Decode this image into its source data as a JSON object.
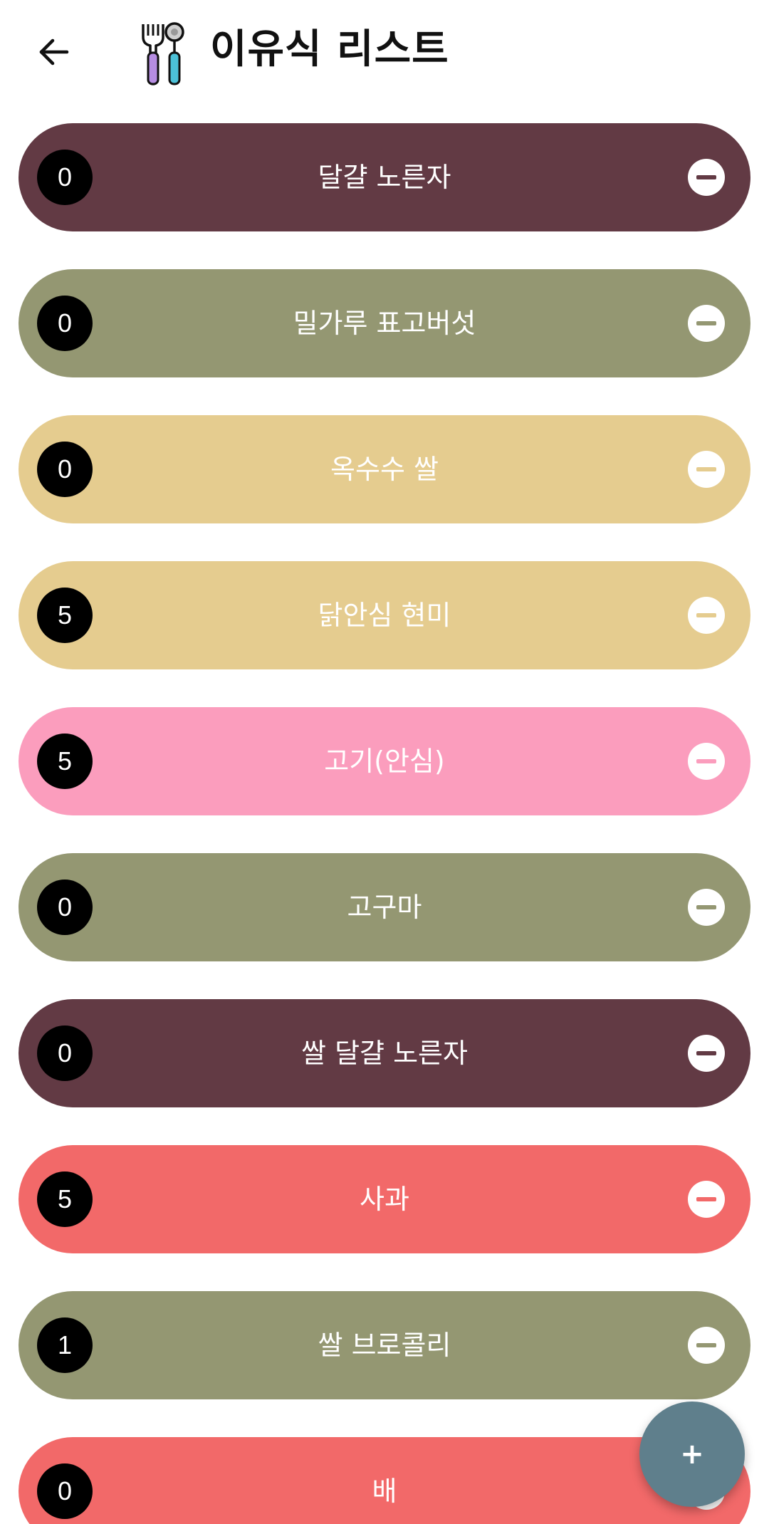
{
  "header": {
    "title": "이유식 리스트",
    "back_icon": "arrow-left-icon",
    "app_icon": "fork-spoon-icon"
  },
  "items": [
    {
      "name": "달걀 노른자",
      "count": "0",
      "color": "#623a44"
    },
    {
      "name": "밀가루 표고버섯",
      "count": "0",
      "color": "#949772"
    },
    {
      "name": "옥수수 쌀",
      "count": "0",
      "color": "#e5cc8f"
    },
    {
      "name": "닭안심 현미",
      "count": "5",
      "color": "#e5cc8f"
    },
    {
      "name": "고기(안심)",
      "count": "5",
      "color": "#fb9dbd"
    },
    {
      "name": "고구마",
      "count": "0",
      "color": "#949772"
    },
    {
      "name": "쌀 달걀 노른자",
      "count": "0",
      "color": "#623a44"
    },
    {
      "name": "사과",
      "count": "5",
      "color": "#f26969"
    },
    {
      "name": "쌀 브로콜리",
      "count": "1",
      "color": "#949772"
    },
    {
      "name": "배",
      "count": "0",
      "color": "#f26969"
    }
  ],
  "remove_icon": "minus-circle-icon",
  "fab": {
    "label": "+",
    "icon": "plus-icon",
    "color": "#5f7f8c"
  }
}
